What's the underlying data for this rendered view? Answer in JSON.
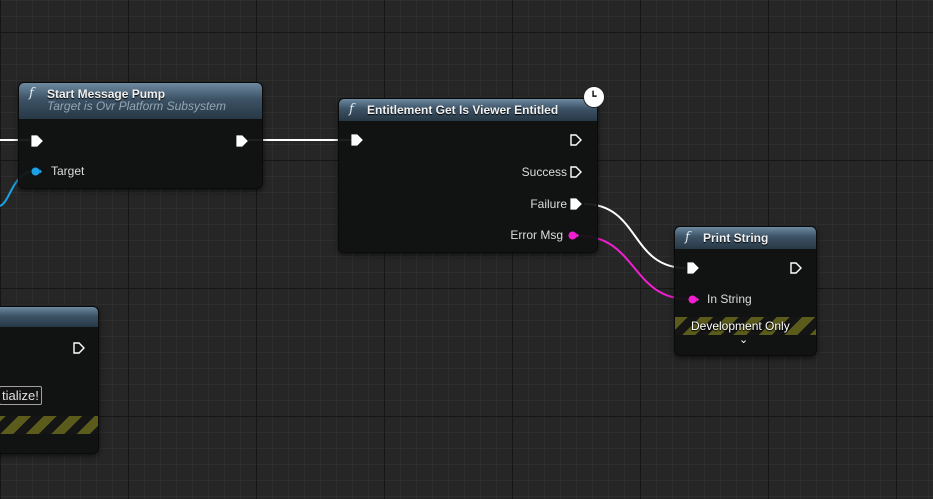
{
  "colors": {
    "exec": "#ffffff",
    "object_pin": "#1da1e6",
    "string_pin": "#f21ed2",
    "header_top": "#6d8aa1",
    "header_bottom": "#273845"
  },
  "icons": {
    "function": "function-icon",
    "exec": "exec-pin-icon",
    "latent": "clock-icon"
  },
  "nodes": {
    "start_pump": {
      "fn_symbol": "f",
      "title": "Start Message Pump",
      "subtitle": "Target is Ovr Platform Subsystem",
      "target_label": "Target"
    },
    "entitlement": {
      "fn_symbol": "f",
      "title": "Entitlement Get Is Viewer Entitled",
      "success_label": "Success",
      "failure_label": "Failure",
      "error_label": "Error Msg"
    },
    "print_string": {
      "fn_symbol": "f",
      "title": "Print String",
      "in_string_label": "In String",
      "dev_only_label": "Development Only",
      "expand_glyph": "⌄"
    },
    "partial_left": {
      "text_value": "tialize!"
    }
  }
}
